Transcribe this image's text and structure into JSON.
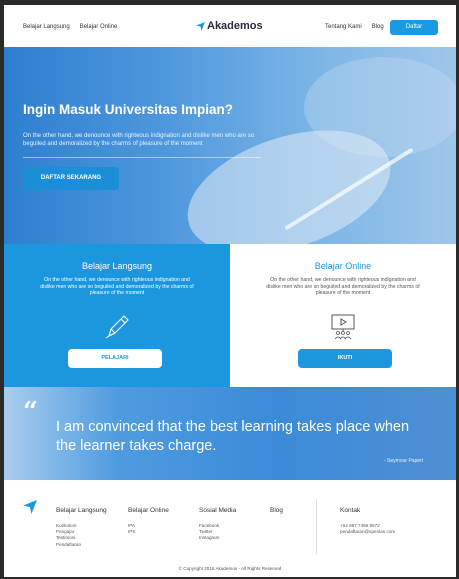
{
  "header": {
    "nav_left": [
      "Belajar Langsung",
      "Belajar Online"
    ],
    "logo_text": "Akademos",
    "nav_right": [
      "Tentang Kami",
      "Blog"
    ],
    "cta_label": "Daftar"
  },
  "hero": {
    "title": "Ingin Masuk Universitas Impian?",
    "text": "On the other hand, we denounce with righteous indignation and dislike men who are so beguiled and demoralized by the charms of pleasure of the moment",
    "cta_label": "DAFTAR SEKARANG"
  },
  "features": {
    "left": {
      "title": "Belajar Langsung",
      "text": "On the other hand, we denounce with righteous indignation and dislike men who are so beguiled and demoralized by the charms of pleasure of the moment",
      "button": "PELAJARI",
      "icon": "pencil-icon"
    },
    "right": {
      "title": "Belajar Online",
      "text": "On the other hand, we denounce with righteous indignation and dislike men who are so beguiled and demoralized by the charms of pleasure of the moment",
      "button": "IKUTI",
      "icon": "video-lesson-icon"
    }
  },
  "quote": {
    "mark": "“",
    "text": "I am convinced that the best learning takes place when the learner takes charge.",
    "author": "- Seymour Papert"
  },
  "footer": {
    "columns": [
      {
        "title": "Belajar Langsung",
        "items": [
          "Kurikulum",
          "Pengajar",
          "Testimoni",
          "Pendaftaran"
        ]
      },
      {
        "title": "Belajar Online",
        "items": [
          "IPA",
          "IPS"
        ]
      },
      {
        "title": "Sosial Media",
        "items": [
          "Facebook",
          "Twitter",
          "Instagram"
        ]
      },
      {
        "title": "Blog",
        "items": []
      },
      {
        "title": "Kontak",
        "items": [
          "+62 857 7456 9672",
          "pendaftaran@spenlan.com"
        ]
      }
    ],
    "copyright": "© Copyright 2016 Akademos - All Rights Reserved"
  },
  "colors": {
    "accent": "#1a97df",
    "text_dark": "#2b2b3a"
  }
}
